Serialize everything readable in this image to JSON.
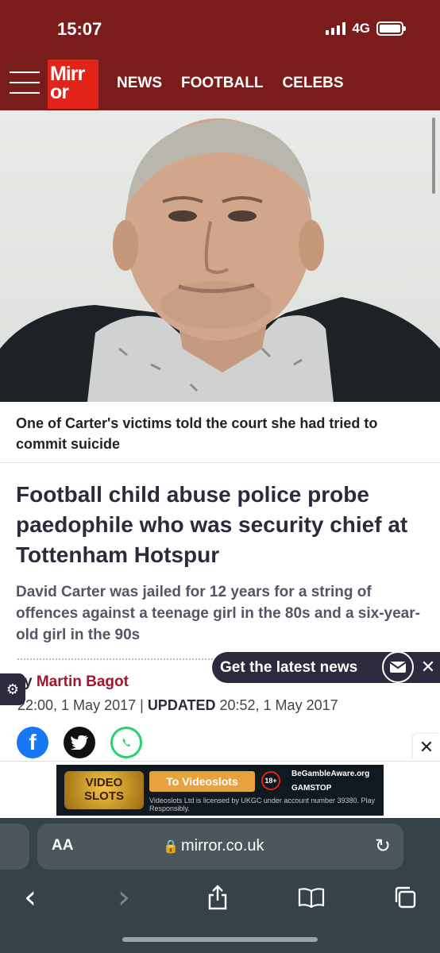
{
  "status": {
    "time": "15:07",
    "network": "4G"
  },
  "nav": {
    "logo_top": "Mirr",
    "logo_bottom": "or",
    "items": [
      "NEWS",
      "FOOTBALL",
      "CELEBS"
    ]
  },
  "article": {
    "caption": "One of Carter's victims told the court she had tried to commit suicide",
    "headline": "Football child abuse police probe paedophile who was security chief at Tottenham Hotspur",
    "standfirst": "David Carter was jailed for 12 years for a string of offences against a teenage girl in the 80s and a six-year-old girl in the 90s",
    "byline_prefix": "y",
    "author": "Martin Bagot",
    "published": "22:00, 1 May 2017",
    "updated_label": "UPDATED",
    "updated": "20:52, 1 May 2017"
  },
  "newsletter": {
    "label": "Get the latest news"
  },
  "ad": {
    "logo_line1": "VIDEO",
    "logo_line2": "SLOTS",
    "button": "To Videoslots",
    "age": "18+",
    "bga": "BeGambleAware.org",
    "gamstop": "GAMSTOP",
    "legal": "Videoslots Ltd is licensed by UKGC under account number 39380. Play Responsibly."
  },
  "browser": {
    "aa_label": "AA",
    "url": "mirror.co.uk"
  },
  "icons": {
    "close": "✕",
    "gear": "⚙",
    "back": "‹",
    "forward": "›",
    "share": "⇧",
    "bookmarks": "📖",
    "tabs": "⧉",
    "reload": "↻",
    "lock": "🔒"
  },
  "colors": {
    "header": "#7a1c1c",
    "brand_red": "#e2231a",
    "author": "#a1172b",
    "navy": "#2b2b3d"
  }
}
